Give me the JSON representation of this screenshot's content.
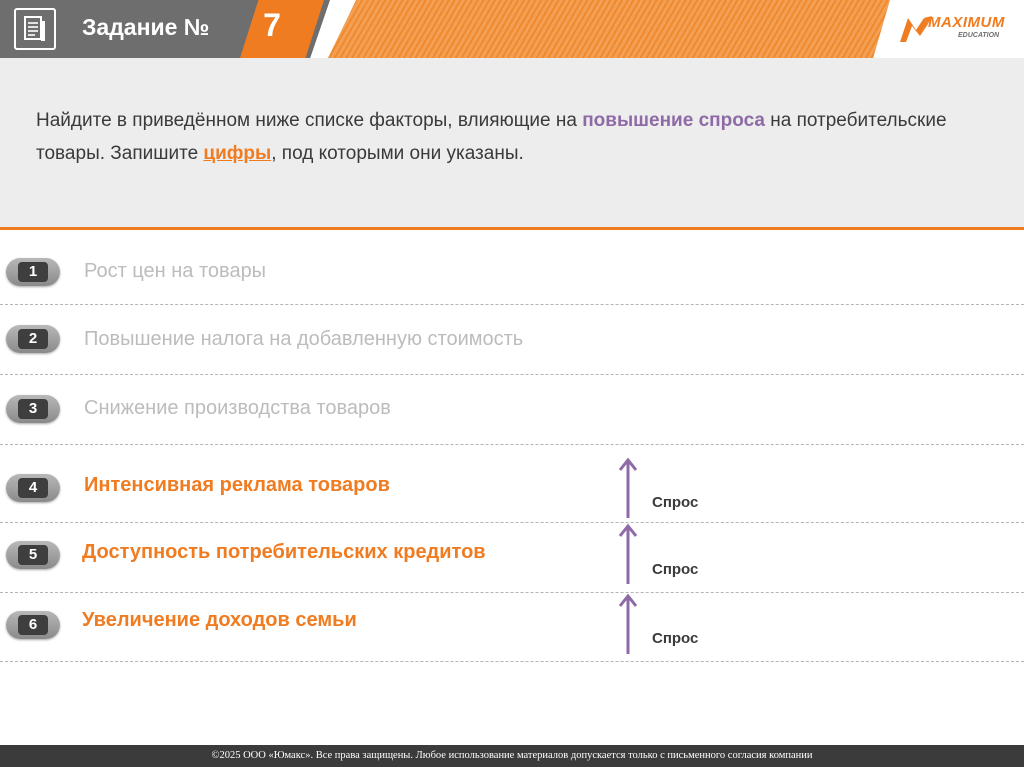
{
  "header": {
    "title": "Задание №",
    "number": "7",
    "logo_text": "MAXIMUM",
    "logo_sub": "EDUCATION"
  },
  "question": {
    "part1": "Найдите в приведённом ниже списке факторы, влияющие на ",
    "highlight1": "повышение спроса",
    "part2": " на потребительские товары. Запишите ",
    "highlight2": "цифры",
    "part3": ", под которыми они указаны."
  },
  "options": [
    {
      "num": "1",
      "text": "Рост цен на товары"
    },
    {
      "num": "2",
      "text": "Повышение налога на добавленную стоимость"
    },
    {
      "num": "3",
      "text": "Снижение производства товаров"
    },
    {
      "num": "4",
      "text": "Интенсивная реклама товаров",
      "effect": "Спрос"
    },
    {
      "num": "5",
      "text": "Доступность потребительских кредитов",
      "effect": "Спрос"
    },
    {
      "num": "6",
      "text": "Увеличение доходов семьи",
      "effect": "Спрос"
    }
  ],
  "footer": {
    "text": "©2025 ООО «Юмакс». Все права защищены. Любое использование материалов допускается только с  письменного согласия компании"
  },
  "colors": {
    "accent": "#f07c22",
    "highlight": "#8e6aa6",
    "header_gray": "#6e6e6e",
    "arrow": "#8e6aa6"
  }
}
